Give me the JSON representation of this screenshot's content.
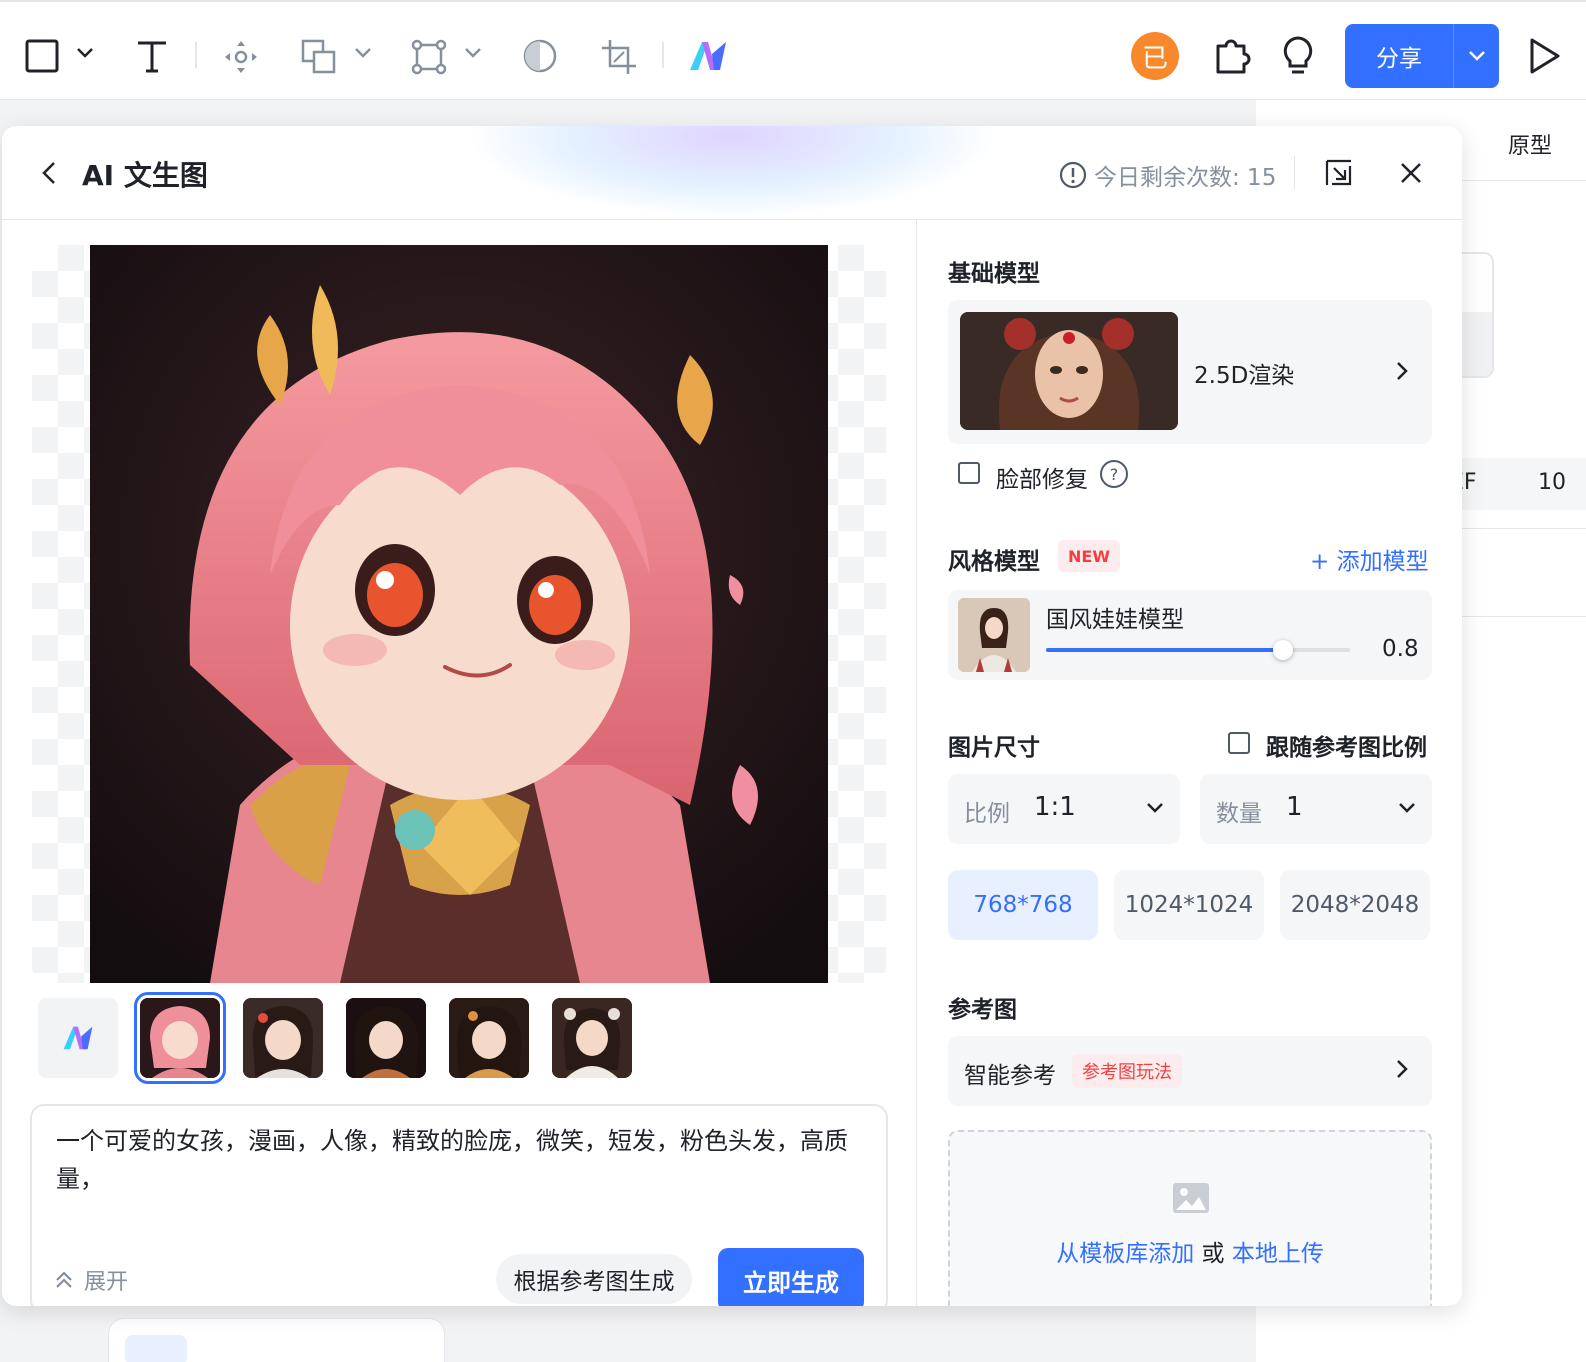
{
  "toolbar": {
    "avatar_label": "已",
    "share_label": "分享"
  },
  "background_panel": {
    "tab_label": "原型",
    "row_left": "EF",
    "row_right": "10"
  },
  "dialog": {
    "title": "AI 文生图",
    "quota_label": "今日剩余次数: 15",
    "prompt_text": "一个可爱的女孩，漫画，人像，精致的脸庞，微笑，短发，粉色头发，高质量，",
    "expand_label": "展开",
    "ref_generate_label": "根据参考图生成",
    "generate_label": "立即生成",
    "thumbnails_selected_index": 0
  },
  "settings": {
    "base_model_heading": "基础模型",
    "base_model_name": "2.5D渲染",
    "face_fix_label": "脸部修复",
    "face_fix_checked": false,
    "style_model_heading": "风格模型",
    "new_badge": "NEW",
    "add_model_label": "+ 添加模型",
    "style_model_name": "国风娃娃模型",
    "style_strength": "0.8",
    "style_strength_fraction": 0.78,
    "size_heading": "图片尺寸",
    "follow_ratio_label": "跟随参考图比例",
    "ratio_key": "比例",
    "ratio_value": "1:1",
    "count_key": "数量",
    "count_value": "1",
    "sizes": [
      "768*768",
      "1024*1024",
      "2048*2048"
    ],
    "selected_size": "768*768",
    "ref_heading": "参考图",
    "smart_ref_label": "智能参考",
    "smart_ref_tag": "参考图玩法",
    "upload_from_lib": "从模板库添加",
    "upload_or": "或",
    "upload_local": "本地上传"
  },
  "colors": {
    "accent": "#3370ff",
    "avatar": "#f7882c",
    "badge_red": "#f53f3f"
  }
}
